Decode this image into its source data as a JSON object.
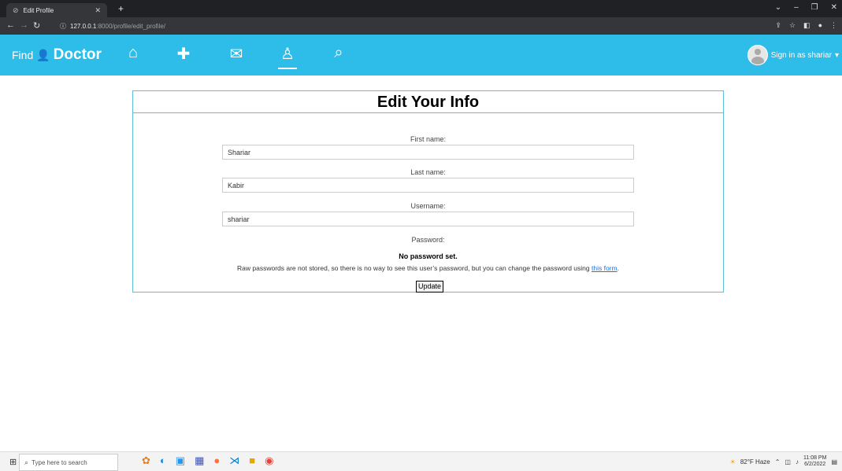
{
  "browser": {
    "tab_title": "Edit Profile",
    "url_host": "127.0.0.1",
    "url_path": ":8000/profile/edit_profile/"
  },
  "header": {
    "brand_find": "Find",
    "brand_doctor": "Doctor",
    "nav_icons": [
      "home-icon",
      "medkit-icon",
      "envelope-icon",
      "user-doctor-icon",
      "search-icon"
    ],
    "active_nav": "user-doctor-icon",
    "signin_text": "Sign in as shariar",
    "accent_color": "#2ebce8"
  },
  "form": {
    "title": "Edit Your Info",
    "first_name_label": "First name:",
    "first_name_value": "Shariar",
    "last_name_label": "Last name:",
    "last_name_value": "Kabir",
    "username_label": "Username:",
    "username_value": "shariar",
    "password_label": "Password:",
    "no_password": "No password set.",
    "password_help": "Raw passwords are not stored, so there is no way to see this user’s password, but you can change the password using",
    "password_link": "this form",
    "password_help_end": ".",
    "update_label": "Update"
  },
  "taskbar": {
    "search_placeholder": "Type here to search",
    "weather": "82°F Haze",
    "time": "11:08 PM",
    "date": "6/2/2022"
  }
}
